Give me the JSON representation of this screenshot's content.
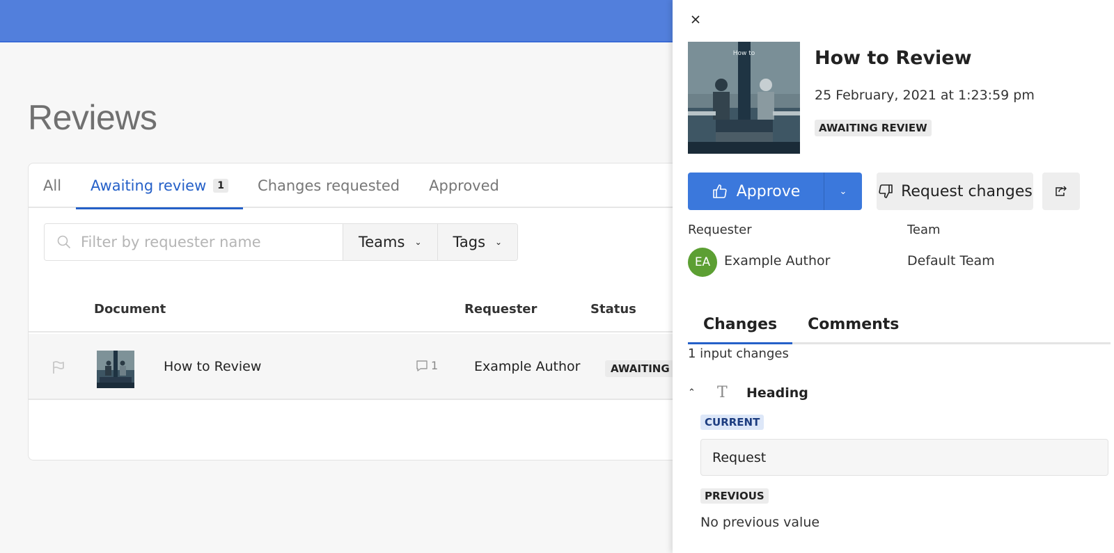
{
  "header": {
    "brand_color": "#527fdc"
  },
  "page": {
    "title": "Reviews"
  },
  "tabs": [
    {
      "label": "All",
      "active": false
    },
    {
      "label": "Awaiting review",
      "count": "1",
      "active": true
    },
    {
      "label": "Changes requested",
      "active": false
    },
    {
      "label": "Approved",
      "active": false
    }
  ],
  "filters": {
    "search_placeholder": "Filter by requester name",
    "search_value": "",
    "teams_label": "Teams",
    "tags_label": "Tags"
  },
  "table": {
    "columns": {
      "document": "Document",
      "requester": "Requester",
      "status": "Status"
    },
    "rows": [
      {
        "title": "How to Review",
        "comment_count": "1",
        "requester": "Example Author",
        "status": "AWAITING REVIEW"
      }
    ]
  },
  "panel": {
    "thumb_caption": "How to",
    "title": "How to Review",
    "date": "25 February, 2021 at 1:23:59 pm",
    "status": "AWAITING REVIEW",
    "approve_label": "Approve",
    "request_changes_label": "Request changes",
    "requester_label": "Requester",
    "team_label": "Team",
    "requester_initials": "EA",
    "requester_name": "Example Author",
    "team_name": "Default Team",
    "tabs": [
      {
        "label": "Changes",
        "active": true
      },
      {
        "label": "Comments",
        "active": false
      }
    ],
    "changes_count_text": "1 input changes",
    "change": {
      "field_icon_glyph": "T",
      "field_name": "Heading",
      "current_label": "CURRENT",
      "current_value": "Request",
      "previous_label": "PREVIOUS",
      "previous_value": "No previous value"
    },
    "colors": {
      "primary": "#3b78dc",
      "avatar": "#5c9f33",
      "active_tab": "#2560c8"
    }
  }
}
